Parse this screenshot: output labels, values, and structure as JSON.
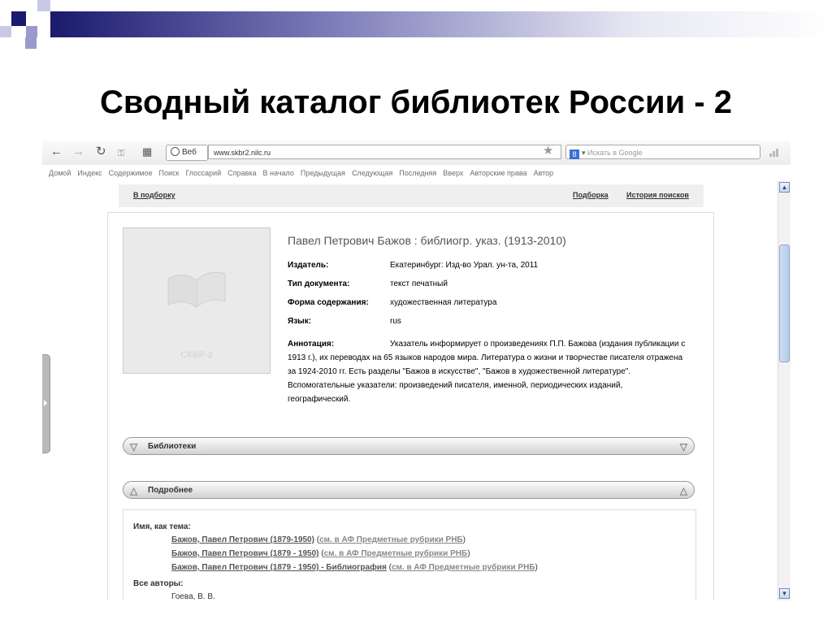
{
  "slide": {
    "title": "Сводный каталог библиотек России - 2"
  },
  "browser": {
    "toolbar": {
      "url_tag": "Веб",
      "url": "www.skbr2.nilc.ru",
      "search_placeholder": "Искать в Google"
    },
    "links": [
      "Домой",
      "Индекс",
      "Содержимое",
      "Поиск",
      "Глоссарий",
      "Справка",
      "В начало",
      "Предыдущая",
      "Следующая",
      "Последняя",
      "Вверх",
      "Авторские права",
      "Автор"
    ]
  },
  "nav": {
    "to_selection": "В подборку",
    "selection": "Подборка",
    "search_history": "История поисков"
  },
  "record": {
    "cover_text": "СКБР-2",
    "title": "Павел Петрович Бажов : библиогр. указ. (1913-2010)",
    "fields": [
      {
        "label": "Издатель:",
        "value": "Екатеринбург: Изд-во Урал. ун-та, 2011"
      },
      {
        "label": "Тип документа:",
        "value": "текст печатный"
      },
      {
        "label": "Форма содержания:",
        "value": "художественная литература"
      },
      {
        "label": "Язык:",
        "value": "rus"
      }
    ],
    "annotation_label": "Аннотация:",
    "annotation": "Указатель информирует о произведениях П.П. Бажова (издания публикации с 1913 г.), их переводах на 65 языков народов мира. Литература о жизни и творчестве писателя отражена за 1924-2010 гг. Есть разделы \"Бажов в искусстве\", \"Бажов в художественной литературе\". Вспомогательные указатели: произведений писателя, именной, периодических изданий, географический."
  },
  "sections": {
    "libraries": "Библиотеки",
    "details": "Подробнее"
  },
  "details": {
    "subject_heading": "Имя, как тема:",
    "subjects": [
      {
        "name": "Бажов, Павел Петрович (1879-1950)",
        "open": " (",
        "link": "см. в АФ Предметные рубрики РНБ",
        "close": ")"
      },
      {
        "name": "Бажов, Павел Петрович (1879 - 1950)",
        "open": " (",
        "link": "см. в АФ Предметные рубрики РНБ",
        "close": ")"
      },
      {
        "name": "Бажов, Павел Петрович (1879 - 1950) - Библиография",
        "open": " (",
        "link": "см. в АФ Предметные рубрики РНБ",
        "close": ")"
      }
    ],
    "authors_heading": "Все авторы:",
    "author": "Гоева, В. В."
  }
}
